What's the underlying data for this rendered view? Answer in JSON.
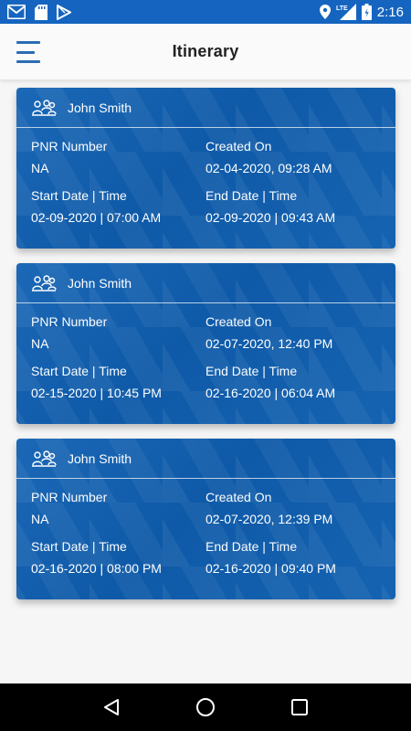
{
  "status_bar": {
    "time": "2:16",
    "icons": [
      "gmail-icon",
      "sd-card-icon",
      "play-store-icon",
      "location-icon",
      "lte-signal-icon",
      "battery-icon"
    ],
    "network_label": "LTE"
  },
  "app_bar": {
    "title": "Itinerary",
    "menu_icon": "hamburger-menu-icon"
  },
  "labels": {
    "pnr": "PNR Number",
    "created": "Created On",
    "start": "Start Date | Time",
    "end": "End Date | Time"
  },
  "cards": [
    {
      "name": "John Smith",
      "pnr": "NA",
      "created_on": "02-04-2020, 09:28 AM",
      "start": "02-09-2020 | 07:00 AM",
      "end": "02-09-2020 | 09:43 AM"
    },
    {
      "name": "John Smith",
      "pnr": "NA",
      "created_on": "02-07-2020, 12:40 PM",
      "start": "02-15-2020 | 10:45 PM",
      "end": "02-16-2020 | 06:04 AM"
    },
    {
      "name": "John Smith",
      "pnr": "NA",
      "created_on": "02-07-2020, 12:39 PM",
      "start": "02-16-2020 | 08:00 PM",
      "end": "02-16-2020 | 09:40 PM"
    }
  ],
  "colors": {
    "status_bar": "#1565c0",
    "card_blue": "#1563b1",
    "menu_icon": "#2b6cb3"
  },
  "nav_bar": {
    "icons": [
      "back-icon",
      "home-icon",
      "recents-icon"
    ]
  }
}
